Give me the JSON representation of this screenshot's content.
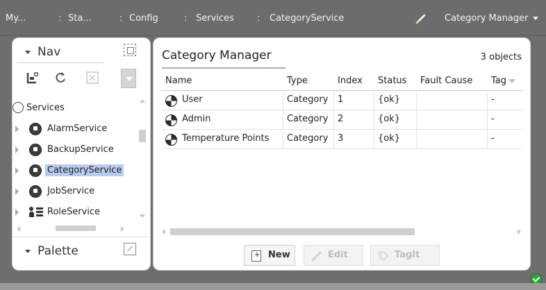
{
  "breadcrumbs": [
    {
      "label": "My..."
    },
    {
      "label": "Sta..."
    },
    {
      "label": "Config"
    },
    {
      "label": "Services"
    },
    {
      "label": "CategoryService"
    }
  ],
  "view_selector": {
    "label": "Category Manager",
    "icon": "pencil-icon"
  },
  "nav": {
    "title": "Nav",
    "tools": [
      {
        "icon": "home-station-icon"
      },
      {
        "icon": "refresh-icon"
      },
      {
        "icon": "close-disabled-icon"
      },
      {
        "icon": "dropdown-icon"
      }
    ],
    "tree": [
      {
        "label": "Services",
        "icon": "services-icon",
        "root": true
      },
      {
        "label": "AlarmService",
        "icon": "alarm-service-icon"
      },
      {
        "label": "BackupService",
        "icon": "backup-service-icon"
      },
      {
        "label": "CategoryService",
        "icon": "category-service-icon",
        "selected": true
      },
      {
        "label": "JobService",
        "icon": "job-service-icon"
      },
      {
        "label": "RoleService",
        "icon": "role-service-icon"
      }
    ]
  },
  "palette": {
    "title": "Palette"
  },
  "main": {
    "title": "Category Manager",
    "object_count": "3 objects",
    "columns": [
      "Name",
      "Type",
      "Index",
      "Status",
      "Fault Cause",
      "Tag"
    ],
    "rows": [
      {
        "name": "User",
        "type": "Category",
        "index": "1",
        "status": "{ok}",
        "fault": "",
        "tag": "-"
      },
      {
        "name": "Admin",
        "type": "Category",
        "index": "2",
        "status": "{ok}",
        "fault": "",
        "tag": "-"
      },
      {
        "name": "Temperature Points",
        "type": "Category",
        "index": "3",
        "status": "{ok}",
        "fault": "",
        "tag": "-"
      }
    ],
    "buttons": [
      {
        "label": "New",
        "enabled": true
      },
      {
        "label": "Edit",
        "enabled": false
      },
      {
        "label": "TagIt",
        "enabled": false
      }
    ]
  },
  "colors": {
    "selected_row": "#b7cbef",
    "status_ok": "#2fa83b",
    "topbar": "#6c6c6c"
  }
}
